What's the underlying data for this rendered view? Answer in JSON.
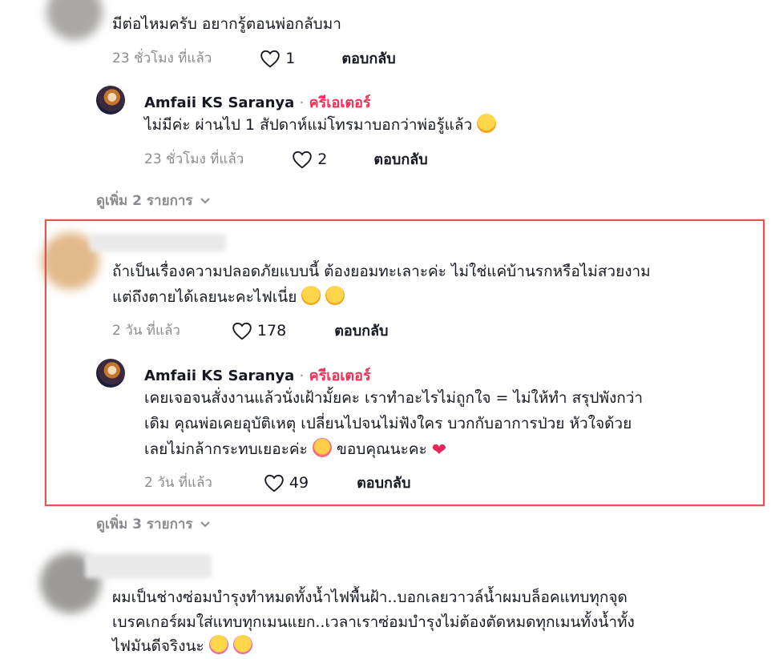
{
  "comments": [
    {
      "text": "มีต่อไหมครับ อยากรู้ตอนพ่อกลับมา",
      "time": "23 ชั่วโมง ที่แล้ว",
      "likes": "1",
      "reply_label": "ตอบกลับ",
      "reply": {
        "author": "Amfaii KS Saranya",
        "separator": "·",
        "badge": "ครีเอเตอร์",
        "text": "ไม่มีค่ะ ผ่านไป 1 สัปดาห์แม่โทรมาบอกว่าพ่อรู้แล้ว",
        "time": "23 ชั่วโมง ที่แล้ว",
        "likes": "2",
        "reply_label": "ตอบกลับ"
      },
      "more": "ดูเพิ่ม 2 รายการ"
    },
    {
      "text_lines": [
        "ถ้าเป็นเรื่องความปลอดภัยแบบนี้ ต้องยอมทะเลาะค่ะ ไม่ใช่แค่บ้านรกหรือไม่สวยงาม",
        "แต่ถึงตายได้เลยนะคะไฟเนี่ย"
      ],
      "time": "2 วัน ที่แล้ว",
      "likes": "178",
      "reply_label": "ตอบกลับ",
      "reply": {
        "author": "Amfaii KS Saranya",
        "separator": "·",
        "badge": "ครีเอเตอร์",
        "text_lines": [
          "เคยเจอจนสั่งงานแล้วนั่งเฝ้ามั้ยคะ เราทำอะไรไม่ถูกใจ = ไม่ให้ทำ สรุปพังกว่า",
          "เดิม คุณพ่อเคยอุบัติเหตุ เปลี่ยนไปจนไม่ฟังใคร บวกกับอาการป่วย หัวใจด้วย",
          "เลยไม่กล้ากระทบเยอะค่ะ",
          "ขอบคุณนะคะ"
        ],
        "time": "2 วัน ที่แล้ว",
        "likes": "49",
        "reply_label": "ตอบกลับ"
      },
      "more": "ดูเพิ่ม 3 รายการ"
    },
    {
      "text_lines": [
        "ผมเป็นช่างซ่อมบำรุงทำหมดทั้งน้ำไฟพื้นฝ้า..บอกเลยวาวล์น้ำผมบล็อคแทบทุกจุด",
        "เบรคเกอร์ผมใส่แทบทุกเมนแยก..เวลาเราซ่อมบำรุงไม่ต้องตัดหมดทุกเมนทั้งน้ำทั้ง",
        "ไฟมันดีจริงนะ"
      ]
    }
  ],
  "colors": {
    "creator_badge": "#fe2c55",
    "highlight_border": "#e55454",
    "meta_text": "#8a8b91"
  }
}
